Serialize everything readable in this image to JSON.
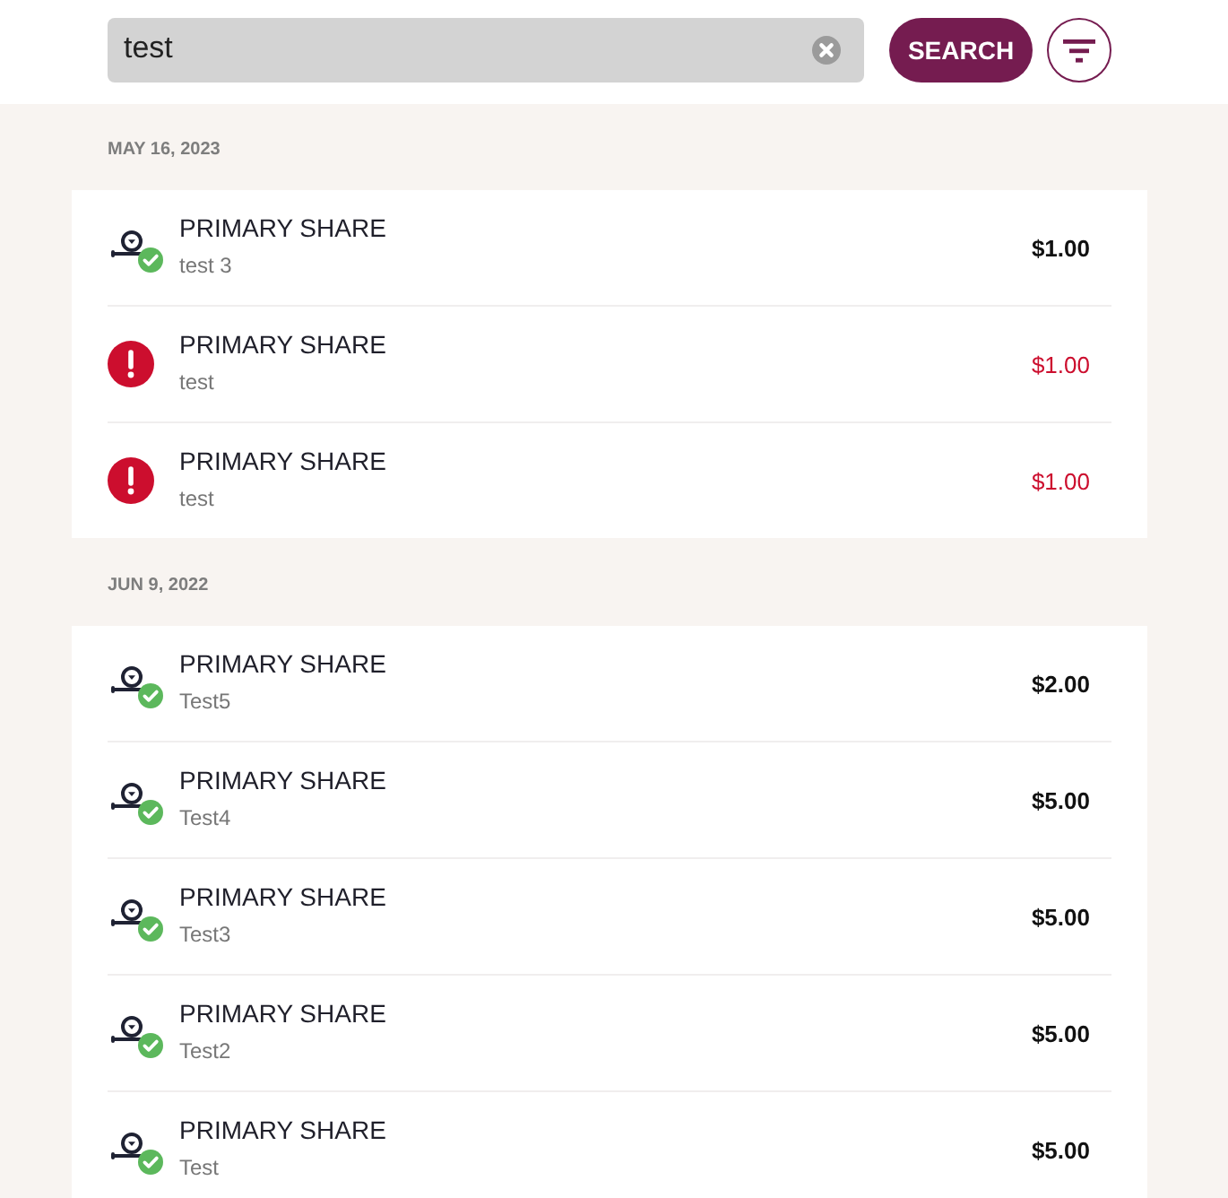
{
  "search": {
    "value": "test",
    "button": "SEARCH"
  },
  "groups": [
    {
      "date": "MAY 16, 2023",
      "transactions": [
        {
          "kind": "completed",
          "title": "PRIMARY SHARE",
          "subtitle": "test 3",
          "amount": "$1.00"
        },
        {
          "kind": "failed",
          "title": "PRIMARY SHARE",
          "subtitle": "test",
          "amount": "$1.00"
        },
        {
          "kind": "failed",
          "title": "PRIMARY SHARE",
          "subtitle": "test",
          "amount": "$1.00"
        }
      ]
    },
    {
      "date": "JUN 9, 2022",
      "transactions": [
        {
          "kind": "completed",
          "title": "PRIMARY SHARE",
          "subtitle": "Test5",
          "amount": "$2.00"
        },
        {
          "kind": "completed",
          "title": "PRIMARY SHARE",
          "subtitle": "Test4",
          "amount": "$5.00"
        },
        {
          "kind": "completed",
          "title": "PRIMARY SHARE",
          "subtitle": "Test3",
          "amount": "$5.00"
        },
        {
          "kind": "completed",
          "title": "PRIMARY SHARE",
          "subtitle": "Test2",
          "amount": "$5.00"
        },
        {
          "kind": "completed",
          "title": "PRIMARY SHARE",
          "subtitle": "Test",
          "amount": "$5.00"
        }
      ]
    }
  ]
}
